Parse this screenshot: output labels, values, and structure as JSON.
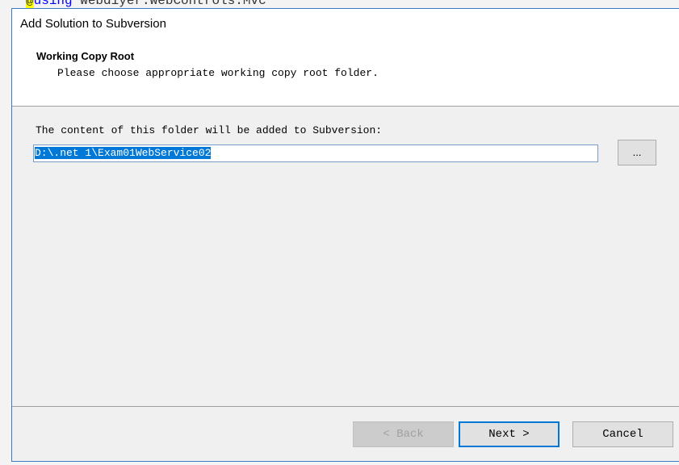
{
  "background": {
    "code_kw": "using",
    "code_rest": " Webdiyer.WebControls.Mvc",
    "code_at": "@"
  },
  "dialog": {
    "title": "Add Solution to Subversion",
    "header_title": "Working Copy Root",
    "header_subtitle": "Please choose appropriate working copy root folder.",
    "folder_label": "The content of this folder will be added to Subversion:",
    "folder_value": "D:\\.net 1\\Exam01WebService02",
    "browse_label": "...",
    "back_label": "< Back",
    "next_label": "Next >",
    "cancel_label": "Cancel"
  },
  "colors": {
    "accent": "#0078d7"
  }
}
